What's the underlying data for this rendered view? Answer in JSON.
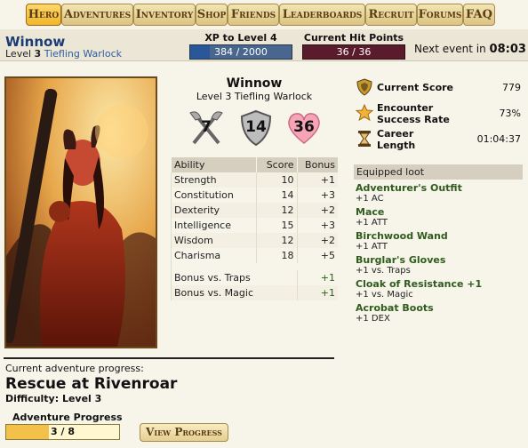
{
  "nav": {
    "tabs": [
      "Hero",
      "Adventures",
      "Inventory",
      "Shop",
      "Friends",
      "Leaderboards",
      "Recruit",
      "Forums",
      "FAQ"
    ],
    "active": "Hero"
  },
  "header": {
    "name": "Winnow",
    "level_prefix": "Level",
    "level": "3",
    "class": "Tiefling Warlock",
    "xp_label": "XP to Level 4",
    "xp_value": "384 / 2000",
    "xp_fraction": 0.192,
    "hp_label": "Current Hit Points",
    "hp_value": "36 / 36",
    "hp_fraction": 1.0,
    "next_event_label": "Next event in",
    "next_event_time": "08:03"
  },
  "character": {
    "name": "Winnow",
    "subtitle": "Level 3 Tiefling Warlock",
    "attack": "7",
    "armor": "14",
    "hit_points": "36"
  },
  "abilities": {
    "headers": [
      "Ability",
      "Score",
      "Bonus"
    ],
    "rows": [
      [
        "Strength",
        "10",
        "+1"
      ],
      [
        "Constitution",
        "14",
        "+3"
      ],
      [
        "Dexterity",
        "12",
        "+2"
      ],
      [
        "Intelligence",
        "15",
        "+3"
      ],
      [
        "Wisdom",
        "12",
        "+2"
      ],
      [
        "Charisma",
        "18",
        "+5"
      ]
    ],
    "bonuses": [
      [
        "Bonus vs. Traps",
        "+1"
      ],
      [
        "Bonus vs. Magic",
        "+1"
      ]
    ]
  },
  "stats": {
    "score_label": "Current Score",
    "score_value": "779",
    "encounter_label": "Encounter Success Rate",
    "encounter_value": "73%",
    "career_label": "Career Length",
    "career_value": "01:04:37"
  },
  "loot": {
    "header": "Equipped loot",
    "items": [
      {
        "name": "Adventurer's Outfit",
        "bonus": "+1 AC"
      },
      {
        "name": "Mace",
        "bonus": "+1 ATT"
      },
      {
        "name": "Birchwood Wand",
        "bonus": "+1 ATT"
      },
      {
        "name": "Burglar's Gloves",
        "bonus": "+1 vs. Traps"
      },
      {
        "name": "Cloak of Resistance +1",
        "bonus": "+1 vs. Magic"
      },
      {
        "name": "Acrobat Boots",
        "bonus": "+1 DEX"
      }
    ]
  },
  "adventure": {
    "caption": "Current adventure progress:",
    "title": "Rescue at Rivenroar",
    "difficulty": "Difficulty: Level 3",
    "progress_label": "Adventure Progress",
    "progress_value": "3 / 8",
    "progress_fraction": 0.375,
    "view_button": "View Progress"
  },
  "colors": {
    "accent_gold": "#f0b62c",
    "name_blue": "#1a3c74",
    "loot_green": "#2f5b1c",
    "hp_dark": "#5a1b2c",
    "xp_blue": "#2a5798"
  }
}
